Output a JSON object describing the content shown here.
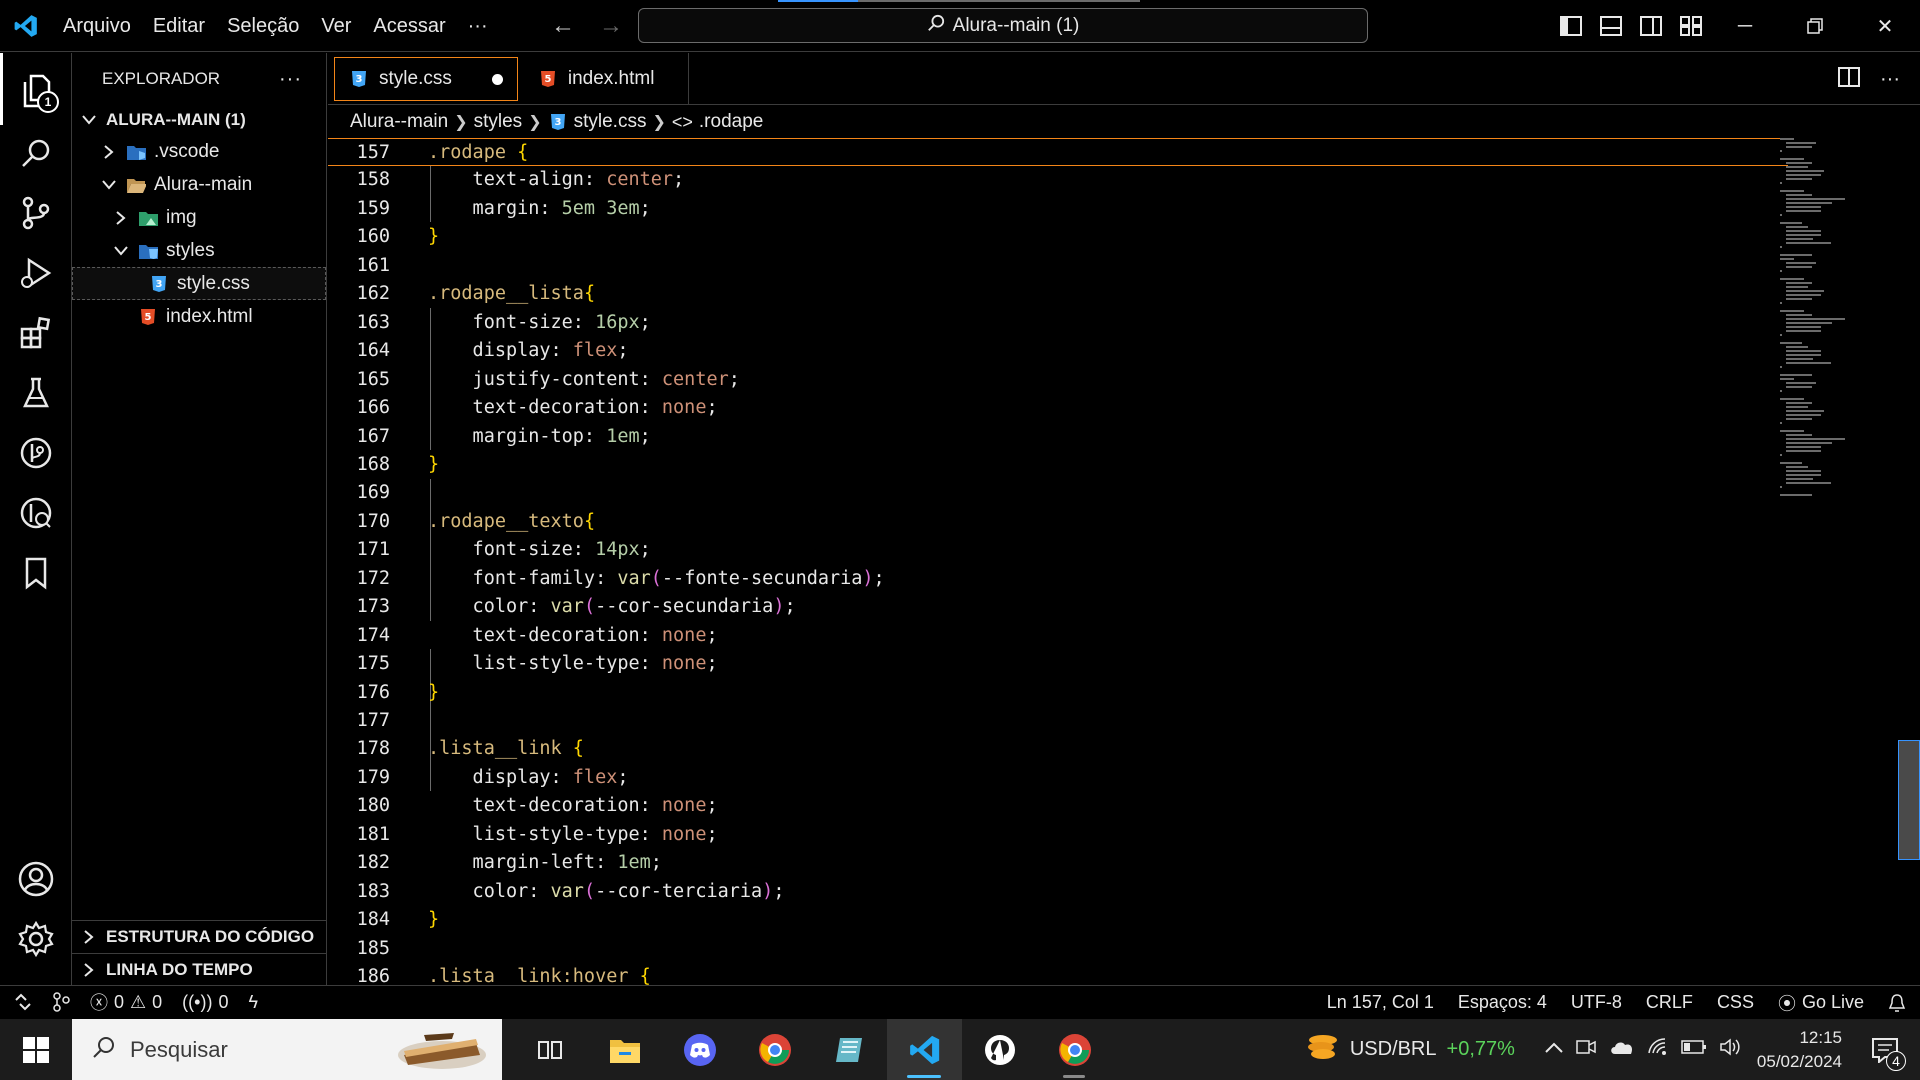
{
  "titlebar": {
    "menu": [
      "Arquivo",
      "Editar",
      "Seleção",
      "Ver",
      "Acessar",
      "···"
    ],
    "command_center": "Alura--main (1)"
  },
  "activity": {
    "explorer_badge": "1"
  },
  "sidebar": {
    "title": "EXPLORADOR",
    "more": "···",
    "root": "ALURA--MAIN (1)",
    "tree": [
      {
        "label": ".vscode",
        "level": 1,
        "expanded": false,
        "kind": "folder"
      },
      {
        "label": "Alura--main",
        "level": 1,
        "expanded": true,
        "kind": "folder"
      },
      {
        "label": "img",
        "level": 2,
        "expanded": false,
        "kind": "folder"
      },
      {
        "label": "styles",
        "level": 2,
        "expanded": true,
        "kind": "folder"
      },
      {
        "label": "style.css",
        "level": 3,
        "kind": "css",
        "selected": true
      },
      {
        "label": "index.html",
        "level": 2,
        "kind": "html"
      }
    ],
    "sections": [
      "ESTRUTURA DO CÓDIGO",
      "LINHA DO TEMPO"
    ]
  },
  "tabs": [
    {
      "label": "style.css",
      "active": true,
      "modified": true
    },
    {
      "label": "index.html",
      "active": false,
      "modified": false
    }
  ],
  "breadcrumb": [
    "Alura--main",
    "styles",
    "style.css",
    ".rodape"
  ],
  "code": [
    {
      "n": "157",
      "tokens": [
        [
          "sel",
          ".rodape"
        ],
        [
          "plain",
          " "
        ],
        [
          "brace",
          "{"
        ]
      ],
      "current": true
    },
    {
      "n": "158",
      "tokens": [
        [
          "prop",
          "    text-align: "
        ],
        [
          "val",
          "center"
        ],
        [
          "prop",
          ";"
        ]
      ]
    },
    {
      "n": "159",
      "tokens": [
        [
          "prop",
          "    margin: "
        ],
        [
          "num",
          "5em 3em"
        ],
        [
          "prop",
          ";"
        ]
      ]
    },
    {
      "n": "160",
      "tokens": [
        [
          "brace",
          "}"
        ]
      ]
    },
    {
      "n": "161",
      "tokens": []
    },
    {
      "n": "162",
      "tokens": [
        [
          "sel",
          ".rodape__lista"
        ],
        [
          "brace",
          "{"
        ]
      ]
    },
    {
      "n": "163",
      "tokens": [
        [
          "prop",
          "    font-size: "
        ],
        [
          "num",
          "16px"
        ],
        [
          "prop",
          ";"
        ]
      ]
    },
    {
      "n": "164",
      "tokens": [
        [
          "prop",
          "    display: "
        ],
        [
          "val",
          "flex"
        ],
        [
          "prop",
          ";"
        ]
      ]
    },
    {
      "n": "165",
      "tokens": [
        [
          "prop",
          "    justify-content: "
        ],
        [
          "val",
          "center"
        ],
        [
          "prop",
          ";"
        ]
      ]
    },
    {
      "n": "166",
      "tokens": [
        [
          "prop",
          "    text-decoration: "
        ],
        [
          "val",
          "none"
        ],
        [
          "prop",
          ";"
        ]
      ]
    },
    {
      "n": "167",
      "tokens": [
        [
          "prop",
          "    margin-top: "
        ],
        [
          "num",
          "1em"
        ],
        [
          "prop",
          ";"
        ]
      ]
    },
    {
      "n": "168",
      "tokens": [
        [
          "brace",
          "}"
        ]
      ]
    },
    {
      "n": "169",
      "tokens": []
    },
    {
      "n": "170",
      "tokens": [
        [
          "sel",
          ".rodape__texto"
        ],
        [
          "brace",
          "{"
        ]
      ]
    },
    {
      "n": "171",
      "tokens": [
        [
          "prop",
          "    font-size: "
        ],
        [
          "num",
          "14px"
        ],
        [
          "prop",
          ";"
        ]
      ]
    },
    {
      "n": "172",
      "tokens": [
        [
          "prop",
          "    font-family: "
        ],
        [
          "fn",
          "var"
        ],
        [
          "paren",
          "("
        ],
        [
          "var",
          "--fonte-secundaria"
        ],
        [
          "paren",
          ")"
        ],
        [
          "prop",
          ";"
        ]
      ]
    },
    {
      "n": "173",
      "tokens": [
        [
          "prop",
          "    color: "
        ],
        [
          "fn",
          "var"
        ],
        [
          "paren",
          "("
        ],
        [
          "var",
          "--cor-secundaria"
        ],
        [
          "paren",
          ")"
        ],
        [
          "prop",
          ";"
        ]
      ]
    },
    {
      "n": "174",
      "tokens": [
        [
          "prop",
          "    text-decoration: "
        ],
        [
          "val",
          "none"
        ],
        [
          "prop",
          ";"
        ]
      ]
    },
    {
      "n": "175",
      "tokens": [
        [
          "prop",
          "    list-style-type: "
        ],
        [
          "val",
          "none"
        ],
        [
          "prop",
          ";"
        ]
      ]
    },
    {
      "n": "176",
      "tokens": [
        [
          "brace",
          "}"
        ]
      ]
    },
    {
      "n": "177",
      "tokens": []
    },
    {
      "n": "178",
      "tokens": [
        [
          "sel",
          ".lista__link"
        ],
        [
          "plain",
          " "
        ],
        [
          "brace",
          "{"
        ]
      ]
    },
    {
      "n": "179",
      "tokens": [
        [
          "prop",
          "    display: "
        ],
        [
          "val",
          "flex"
        ],
        [
          "prop",
          ";"
        ]
      ]
    },
    {
      "n": "180",
      "tokens": [
        [
          "prop",
          "    text-decoration: "
        ],
        [
          "val",
          "none"
        ],
        [
          "prop",
          ";"
        ]
      ]
    },
    {
      "n": "181",
      "tokens": [
        [
          "prop",
          "    list-style-type: "
        ],
        [
          "val",
          "none"
        ],
        [
          "prop",
          ";"
        ]
      ]
    },
    {
      "n": "182",
      "tokens": [
        [
          "prop",
          "    margin-left: "
        ],
        [
          "num",
          "1em"
        ],
        [
          "prop",
          ";"
        ]
      ]
    },
    {
      "n": "183",
      "tokens": [
        [
          "prop",
          "    color: "
        ],
        [
          "fn",
          "var"
        ],
        [
          "paren",
          "("
        ],
        [
          "var",
          "--cor-terciaria"
        ],
        [
          "paren",
          ")"
        ],
        [
          "prop",
          ";"
        ]
      ]
    },
    {
      "n": "184",
      "tokens": [
        [
          "brace",
          "}"
        ]
      ]
    },
    {
      "n": "185",
      "tokens": []
    },
    {
      "n": "186",
      "tokens": [
        [
          "sel",
          ".lista__link:hover"
        ],
        [
          "plain",
          " "
        ],
        [
          "brace",
          "{"
        ]
      ]
    }
  ],
  "statusbar": {
    "errors": "0",
    "warnings": "0",
    "ports": "0",
    "position": "Ln 157, Col 1",
    "spaces": "Espaços: 4",
    "encoding": "UTF-8",
    "eol": "CRLF",
    "language": "CSS",
    "golive": "Go Live"
  },
  "taskbar": {
    "search_placeholder": "Pesquisar",
    "stock_label": "USD/BRL",
    "stock_change": "+0,77%",
    "time": "12:15",
    "date": "05/02/2024",
    "notifications": "4"
  },
  "colors": {
    "accent_orange": "#f38518",
    "focus_blue": "#3794ff",
    "css_icon": "#42a5f5",
    "html_icon": "#e44d26",
    "vscode_blue": "#23a9f2"
  }
}
